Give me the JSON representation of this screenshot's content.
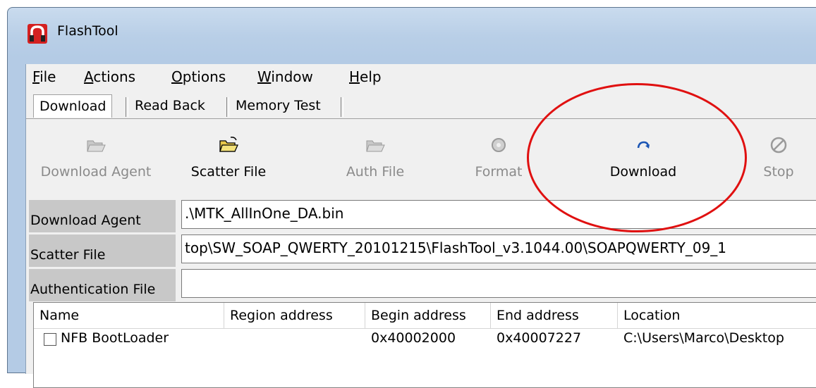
{
  "window": {
    "title": "FlashTool"
  },
  "menu": [
    {
      "label": "File",
      "accel": "F",
      "rest": "ile"
    },
    {
      "label": "Actions",
      "accel": "A",
      "rest": "ctions"
    },
    {
      "label": "Options",
      "accel": "O",
      "rest": "ptions"
    },
    {
      "label": "Window",
      "accel": "W",
      "rest": "indow"
    },
    {
      "label": "Help",
      "accel": "H",
      "rest": "elp"
    }
  ],
  "tabs": [
    "Download",
    "Read Back",
    "Memory Test"
  ],
  "toolbar": {
    "download_agent": "Download Agent",
    "scatter_file": "Scatter File",
    "auth_file": "Auth File",
    "format": "Format",
    "download": "Download",
    "stop": "Stop"
  },
  "fields": {
    "download_agent": {
      "label": "Download Agent",
      "value": ".\\MTK_AllInOne_DA.bin"
    },
    "scatter_file": {
      "label": "Scatter File",
      "value": "top\\SW_SOAP_QWERTY_20101215\\FlashTool_v3.1044.00\\SOAPQWERTY_09_1"
    },
    "authentication_file": {
      "label": "Authentication File",
      "value": ""
    }
  },
  "table": {
    "headers": [
      "Name",
      "Region address",
      "Begin address",
      "End address",
      "Location"
    ],
    "rows": [
      {
        "name": "NFB BootLoader",
        "region": "",
        "begin": "0x40002000",
        "end": "0x40007227",
        "location": "C:\\Users\\Marco\\Desktop"
      }
    ]
  },
  "colors": {
    "annotation": "#e01010",
    "field_label_bg": "#c8c8c8"
  }
}
